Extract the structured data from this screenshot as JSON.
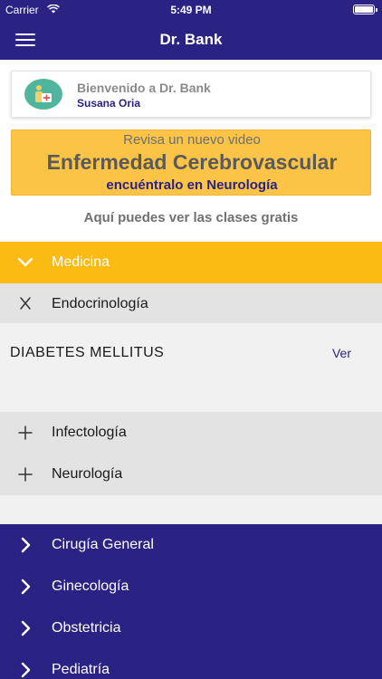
{
  "status_bar": {
    "carrier": "Carrier",
    "time": "5:49 PM"
  },
  "nav": {
    "title": "Dr. Bank"
  },
  "welcome": {
    "greeting": "Bienvenido a Dr. Bank",
    "user": "Susana Oria"
  },
  "video_banner": {
    "line1": "Revisa un nuevo video",
    "line2": "Enfermedad Cerebrovascular",
    "line3": "encuéntralo en Neurología"
  },
  "free_classes": "Aquí puedes ver las clases gratis",
  "accordion": {
    "expanded_category": "Medicina",
    "subcategories": [
      "Endocrinología",
      "Infectología",
      "Neurología"
    ],
    "detail": {
      "title": "DIABETES MELLITUS",
      "link": "Ver"
    },
    "categories": [
      "Cirugía General",
      "Ginecología",
      "Obstetricia",
      "Pediatría"
    ]
  },
  "colors": {
    "primary": "#2a2383",
    "accent": "#fcbb13",
    "banner": "#fcc446"
  }
}
